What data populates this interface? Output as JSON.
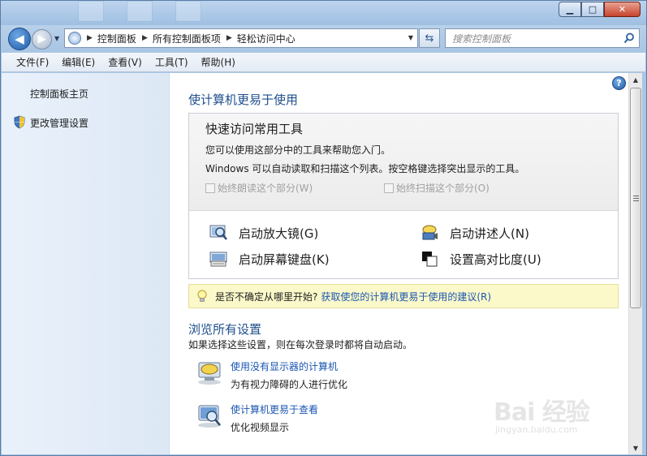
{
  "window": {
    "controls": {
      "minimize": "▁",
      "maximize": "□",
      "close": "✕"
    }
  },
  "nav": {
    "back_glyph": "◀",
    "forward_glyph": "▶"
  },
  "address": {
    "icon": "control-panel-icon",
    "crumbs": [
      "控制面板",
      "所有控制面板项",
      "轻松访问中心"
    ]
  },
  "search": {
    "placeholder": "搜索控制面板"
  },
  "menu": [
    "文件(F)",
    "编辑(E)",
    "查看(V)",
    "工具(T)",
    "帮助(H)"
  ],
  "sidebar": {
    "home": "控制面板主页",
    "admin": "更改管理设置"
  },
  "main": {
    "heading": "使计算机更易于使用",
    "quick": {
      "title": "快速访问常用工具",
      "line1": "您可以使用这部分中的工具来帮助您入门。",
      "line2": "Windows 可以自动读取和扫描这个列表。按空格键选择突出显示的工具。",
      "always_read": "始终朗读这个部分(W)",
      "always_scan": "始终扫描这个部分(O)",
      "tools": {
        "magnifier": "启动放大镜(G)",
        "narrator": "启动讲述人(N)",
        "keyboard": "启动屏幕键盘(K)",
        "contrast": "设置高对比度(U)"
      }
    },
    "tip": {
      "text": "是否不确定从哪里开始?",
      "link": "获取使您的计算机更易于使用的建议(R)"
    },
    "browse": {
      "heading": "浏览所有设置",
      "desc": "如果选择这些设置，则在每次登录时都将自动启动。",
      "items": [
        {
          "link": "使用没有显示器的计算机",
          "desc": "为有视力障碍的人进行优化"
        },
        {
          "link": "使计算机更易于查看",
          "desc": "优化视频显示"
        }
      ]
    }
  },
  "watermark": {
    "logo": "Bai 经验",
    "sub": "jingyan.baidu.com"
  },
  "colors": {
    "link": "#1a56b2",
    "heading": "#1e4e8c",
    "tip_bg": "#fbf8c9"
  }
}
